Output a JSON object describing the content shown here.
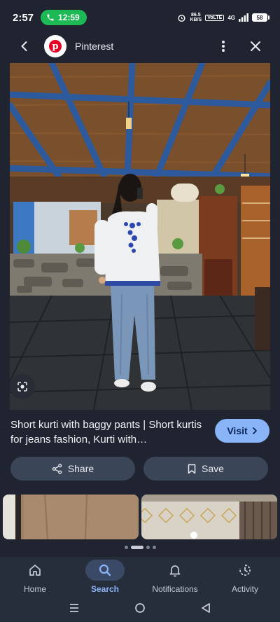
{
  "status_bar": {
    "time": "2:57",
    "call_timer": "12:59",
    "net_speed_value": "86.5",
    "net_speed_unit": "KB/S",
    "volte": "VoLTE",
    "signal_label": "4G",
    "battery": "58"
  },
  "header": {
    "site_name": "Pinterest",
    "site_logo_letter": "p"
  },
  "result": {
    "caption": "Short kurti with baggy pants | Short kurtis for jeans fashion, Kurti with…",
    "visit_label": "Visit"
  },
  "actions": {
    "share_label": "Share",
    "save_label": "Save"
  },
  "bottom_nav": {
    "items": [
      {
        "label": "Home",
        "icon": "home-icon",
        "active": false
      },
      {
        "label": "Search",
        "icon": "search-icon",
        "active": true
      },
      {
        "label": "Notifications",
        "icon": "bell-icon",
        "active": false
      },
      {
        "label": "Activity",
        "icon": "activity-icon",
        "active": false
      }
    ]
  },
  "colors": {
    "background": "#1f2430",
    "accent": "#8ab4f8",
    "call_green": "#1db954",
    "pinterest_red": "#e60023"
  }
}
